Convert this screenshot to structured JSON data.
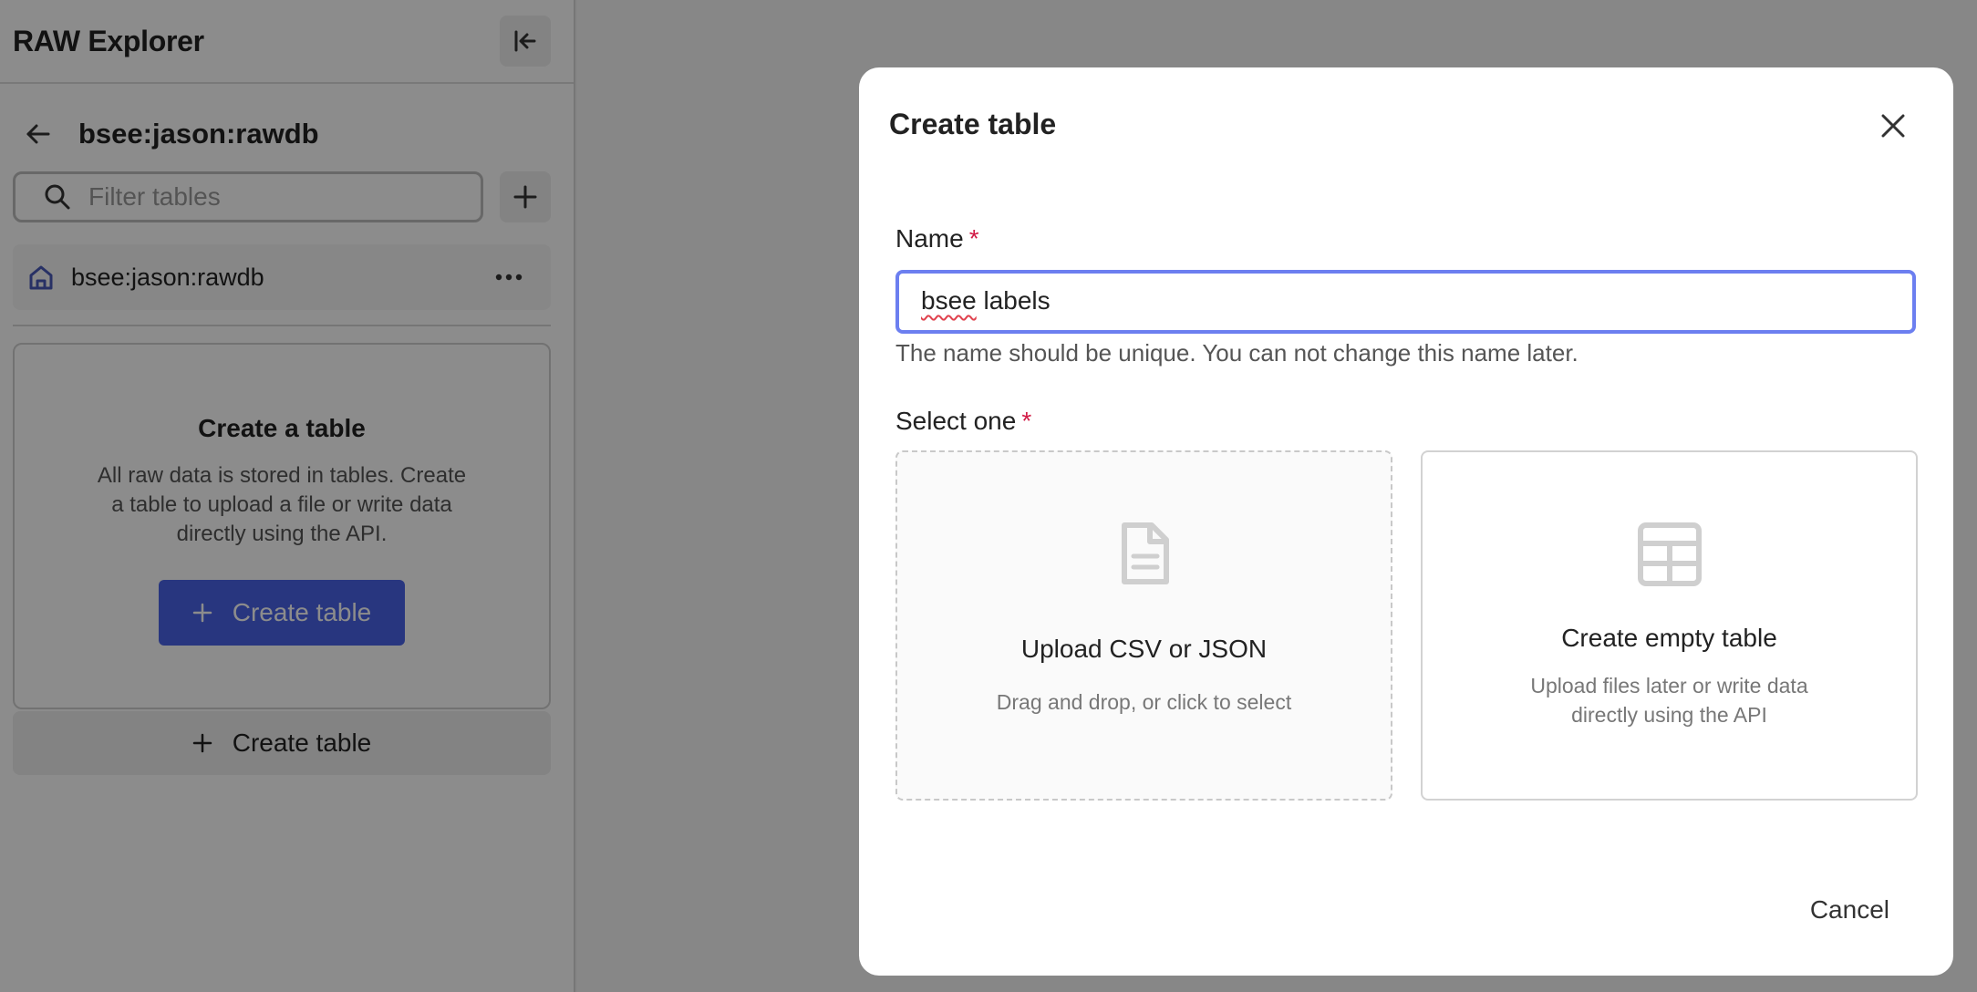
{
  "sidebar": {
    "app_title": "RAW Explorer",
    "database_name": "bsee:jason:rawdb",
    "filter_placeholder": "Filter tables",
    "db_item_label": "bsee:jason:rawdb",
    "empty_state": {
      "title": "Create a table",
      "description": "All raw data is stored in tables. Create a table to upload a file or write data directly using the API.",
      "button_label": "Create table"
    },
    "create_table_label": "Create table"
  },
  "modal": {
    "title": "Create table",
    "name_label": "Name",
    "required_mark": "*",
    "name_value": "bsee labels",
    "name_value_underlined": "bsee",
    "name_value_rest": " labels",
    "helper_text": "The name should be unique. You can not change this name later.",
    "select_label": "Select one",
    "options": [
      {
        "title": "Upload CSV or JSON",
        "description": "Drag and drop, or click to select",
        "icon": "file-icon"
      },
      {
        "title": "Create empty table",
        "description": "Upload files later or write data directly using the API",
        "icon": "table-icon"
      }
    ],
    "cancel_label": "Cancel"
  },
  "colors": {
    "primary": "#4a63e7",
    "focus_border": "#6c7ff0",
    "required": "#d11a45",
    "overlay": "rgba(0,0,0,0.45)"
  }
}
